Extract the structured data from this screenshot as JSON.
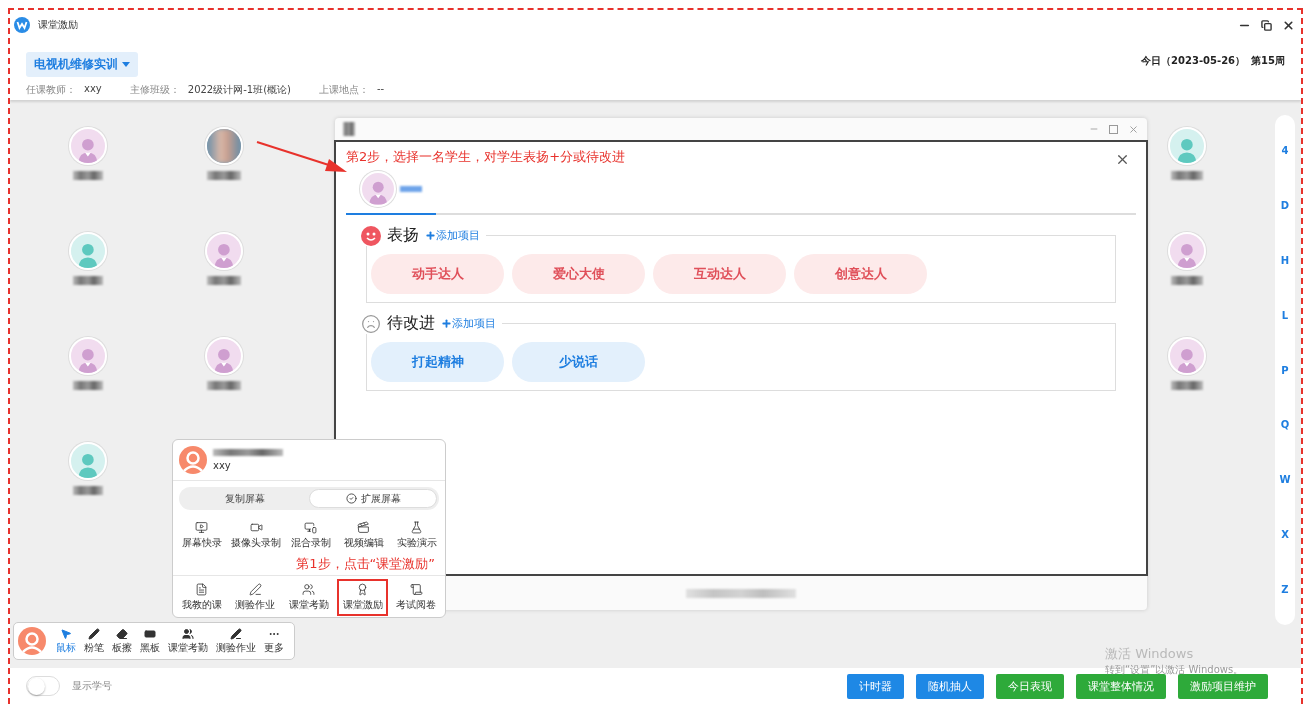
{
  "window": {
    "title": "课堂激励"
  },
  "course": {
    "name": "电视机维修实训"
  },
  "info": [
    {
      "label": "任课教师：",
      "value": "xxy"
    },
    {
      "label": "主修班级：",
      "value": "2022级计网-1班(概论)"
    },
    {
      "label": "上课地点：",
      "value": "--"
    }
  ],
  "today": "今日（2023-05-26）",
  "week": "第15周",
  "students_left": [
    {
      "kind": "female"
    },
    {
      "kind": "photo"
    },
    {
      "kind": "male"
    },
    {
      "kind": "female"
    },
    {
      "kind": "female"
    },
    {
      "kind": "female"
    },
    {
      "kind": "male"
    }
  ],
  "students_right": [
    {
      "kind": "male"
    },
    {
      "kind": "female"
    },
    {
      "kind": "female"
    }
  ],
  "letter_index": [
    "4",
    "D",
    "H",
    "L",
    "P",
    "Q",
    "W",
    "X",
    "Z"
  ],
  "dialog": {
    "annotation": "第2步，选择一名学生，对学生表扬+分或待改进",
    "sections": [
      {
        "kind": "praise",
        "title": "表扬",
        "add_label": "添加项目",
        "items": [
          "动手达人",
          "爱心大使",
          "互动达人",
          "创意达人"
        ]
      },
      {
        "kind": "improve",
        "title": "待改进",
        "add_label": "添加项目",
        "items": [
          "打起精神",
          "少说话"
        ]
      }
    ]
  },
  "popup": {
    "user": "xxy",
    "screen_modes": [
      {
        "label": "复制屏幕",
        "selected": false
      },
      {
        "label": "扩展屏幕",
        "selected": true
      }
    ],
    "tool_rows": [
      [
        {
          "label": "屏幕快录",
          "highlighted": false
        },
        {
          "label": "摄像头录制",
          "highlighted": false
        },
        {
          "label": "混合录制",
          "highlighted": false
        },
        {
          "label": "视频编辑",
          "highlighted": false
        },
        {
          "label": "实验演示",
          "highlighted": false
        }
      ],
      [
        {
          "label": "我教的课",
          "highlighted": false
        },
        {
          "label": "测验作业",
          "highlighted": false
        },
        {
          "label": "课堂考勤",
          "highlighted": false
        },
        {
          "label": "课堂激励",
          "highlighted": true
        },
        {
          "label": "考试阅卷",
          "highlighted": false
        }
      ]
    ],
    "annotation": "第1步，点击“课堂激励”"
  },
  "toolbar": [
    {
      "label": "鼠标",
      "selected": true
    },
    {
      "label": "粉笔",
      "selected": false
    },
    {
      "label": "板擦",
      "selected": false
    },
    {
      "label": "黑板",
      "selected": false
    },
    {
      "label": "课堂考勤",
      "selected": false
    },
    {
      "label": "测验作业",
      "selected": false
    },
    {
      "label": "更多",
      "selected": false
    }
  ],
  "activation_notice": {
    "title": "激活 Windows",
    "subtitle": "转到“设置”以激活 Windows。"
  },
  "footer": {
    "toggle": {
      "label": "显示学号",
      "on": false
    },
    "buttons": [
      {
        "label": "计时器",
        "kind": "primary"
      },
      {
        "label": "随机抽人",
        "kind": "primary"
      },
      {
        "label": "今日表现",
        "kind": "success"
      },
      {
        "label": "课堂整体情况",
        "kind": "success"
      },
      {
        "label": "激励项目维护",
        "kind": "success"
      }
    ]
  }
}
